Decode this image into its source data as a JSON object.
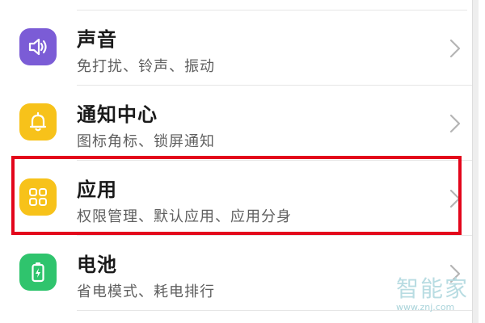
{
  "settings_list": {
    "items": [
      {
        "title": "声音",
        "subtitle": "免打扰、铃声、振动",
        "icon": "speaker-icon",
        "icon_color": "#7b5cd6"
      },
      {
        "title": "通知中心",
        "subtitle": "图标角标、锁屏通知",
        "icon": "bell-icon",
        "icon_color": "#f7c21a"
      },
      {
        "title": "应用",
        "subtitle": "权限管理、默认应用、应用分身",
        "icon": "app-grid-icon",
        "icon_color": "#f7c21a"
      },
      {
        "title": "电池",
        "subtitle": "省电模式、耗电排行",
        "icon": "battery-icon",
        "icon_color": "#2fc46d"
      }
    ]
  },
  "highlight": {
    "target": "应用",
    "color": "#e3061b"
  },
  "watermark": {
    "text": "智能家",
    "url": "www.znj.com"
  }
}
